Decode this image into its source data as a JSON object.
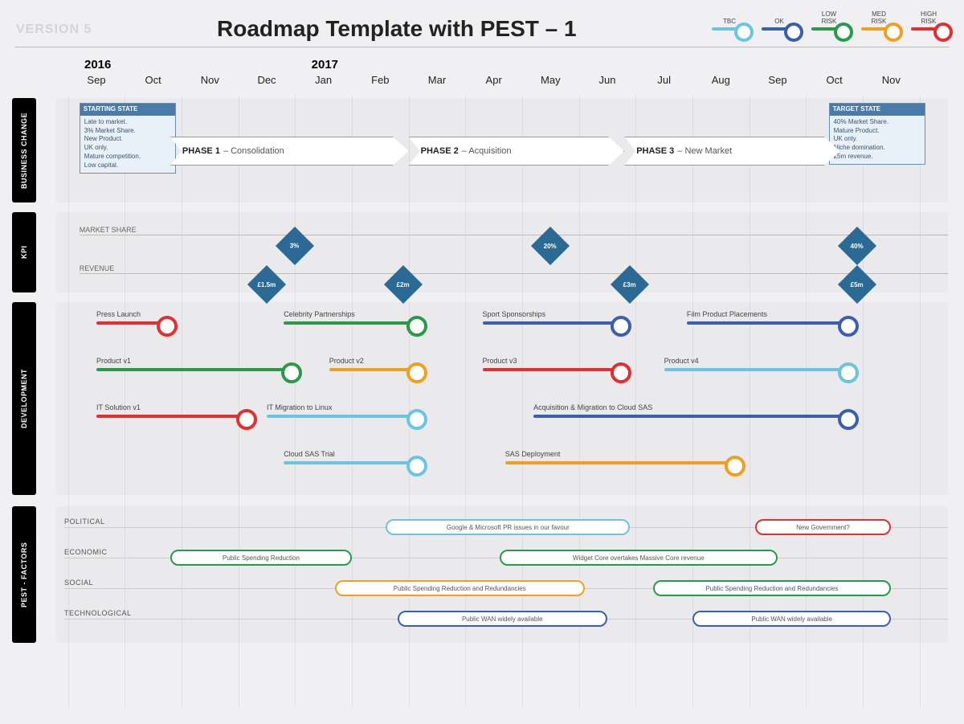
{
  "version": "VERSION 5",
  "title": "Roadmap Template with PEST – 1",
  "legend": [
    {
      "label": "TBC",
      "cls": "tbc"
    },
    {
      "label": "OK",
      "cls": "ok"
    },
    {
      "label": "LOW\nRISK",
      "cls": "low"
    },
    {
      "label": "MED\nRISK",
      "cls": "med"
    },
    {
      "label": "HIGH\nRISK",
      "cls": "high"
    }
  ],
  "timeline": {
    "years": [
      {
        "label": "2016",
        "col": 0
      },
      {
        "label": "2017",
        "col": 4
      }
    ],
    "months": [
      "Sep",
      "Oct",
      "Nov",
      "Dec",
      "Jan",
      "Feb",
      "Mar",
      "Apr",
      "May",
      "Jun",
      "Jul",
      "Aug",
      "Sep",
      "Oct",
      "Nov"
    ]
  },
  "business_change": {
    "label": "BUSINESS CHANGE",
    "starting_state": {
      "title": "STARTING STATE",
      "items": [
        "Late to market.",
        "3% Market Share.",
        "New Product.",
        "UK only.",
        "Mature competition.",
        "Low capital."
      ]
    },
    "target_state": {
      "title": "TARGET STATE",
      "items": [
        "40% Market Share.",
        "Mature Product.",
        "UK only.",
        "Niche domination.",
        "£5m revenue."
      ]
    },
    "phases": [
      {
        "name": "PHASE 1",
        "desc": "Consolidation",
        "start": 1.3,
        "end": 5.5
      },
      {
        "name": "PHASE 2",
        "desc": "Acquisition",
        "start": 5.5,
        "end": 9.3
      },
      {
        "name": "PHASE 3",
        "desc": "New Market",
        "start": 9.3,
        "end": 13.1
      }
    ]
  },
  "kpi": {
    "label": "KPI",
    "rows": [
      {
        "label": "MARKET SHARE",
        "y": 0,
        "markers": [
          {
            "col": 3.5,
            "value": "3%"
          },
          {
            "col": 8,
            "value": "20%"
          },
          {
            "col": 13.4,
            "value": "40%"
          }
        ]
      },
      {
        "label": "REVENUE",
        "y": 1,
        "markers": [
          {
            "col": 3,
            "value": "£1.5m"
          },
          {
            "col": 5.4,
            "value": "£2m"
          },
          {
            "col": 9.4,
            "value": "£3m"
          },
          {
            "col": 13.4,
            "value": "£5m"
          }
        ]
      }
    ]
  },
  "development": {
    "label": "DEVELOPMENT",
    "tracks": [
      {
        "label": "Press Launch",
        "row": 0,
        "start": 0,
        "end": 1.3,
        "cls": "high"
      },
      {
        "label": "Celebrity Partnerships",
        "row": 0,
        "start": 3.3,
        "end": 5.7,
        "cls": "low"
      },
      {
        "label": "Sport Sponsorships",
        "row": 0,
        "start": 6.8,
        "end": 9.3,
        "cls": "ok"
      },
      {
        "label": "Film Product Placements",
        "row": 0,
        "start": 10.4,
        "end": 13.3,
        "cls": "ok"
      },
      {
        "label": "Product v1",
        "row": 1,
        "start": 0,
        "end": 3.5,
        "cls": "low"
      },
      {
        "label": "Product v2",
        "row": 1,
        "start": 4.1,
        "end": 5.7,
        "cls": "med"
      },
      {
        "label": "Product v3",
        "row": 1,
        "start": 6.8,
        "end": 9.3,
        "cls": "high"
      },
      {
        "label": "Product v4",
        "row": 1,
        "start": 10.0,
        "end": 13.3,
        "cls": "tbc"
      },
      {
        "label": "IT Solution v1",
        "row": 2,
        "start": 0,
        "end": 2.7,
        "cls": "high"
      },
      {
        "label": "IT Migration to Linux",
        "row": 2,
        "start": 3.0,
        "end": 5.7,
        "cls": "tbc"
      },
      {
        "label": "Acquisition & Migration to Cloud SAS",
        "row": 2,
        "start": 7.7,
        "end": 13.3,
        "cls": "ok"
      },
      {
        "label": "Cloud SAS Trial",
        "row": 3,
        "start": 3.3,
        "end": 5.7,
        "cls": "tbc"
      },
      {
        "label": "SAS Deployment",
        "row": 3,
        "start": 7.2,
        "end": 11.3,
        "cls": "med"
      }
    ]
  },
  "pest": {
    "label": "PEST - FACTORS",
    "rows": [
      "POLITICAL",
      "ECONOMIC",
      "SOCIAL",
      "TECHNOLOGICAL"
    ],
    "items": [
      {
        "row": 0,
        "start": 5.1,
        "end": 9.4,
        "cls": "tbc",
        "text": "Google & Microsoft PR issues in our favour"
      },
      {
        "row": 0,
        "start": 11.6,
        "end": 14.0,
        "cls": "high",
        "text": "New Government?"
      },
      {
        "row": 1,
        "start": 1.3,
        "end": 4.5,
        "cls": "low",
        "text": "Public Spending Reduction"
      },
      {
        "row": 1,
        "start": 7.1,
        "end": 12.0,
        "cls": "low",
        "text": "Widget Core overtakes Massive Core revenue"
      },
      {
        "row": 2,
        "start": 4.2,
        "end": 8.6,
        "cls": "med",
        "text": "Public Spending Reduction and Redundancies"
      },
      {
        "row": 2,
        "start": 9.8,
        "end": 14.0,
        "cls": "low",
        "text": "Public Spending Reduction and Redundancies"
      },
      {
        "row": 3,
        "start": 5.3,
        "end": 9.0,
        "cls": "ok",
        "text": "Public WAN widely available"
      },
      {
        "row": 3,
        "start": 10.5,
        "end": 14.0,
        "cls": "ok",
        "text": "Public WAN widely available"
      }
    ]
  }
}
